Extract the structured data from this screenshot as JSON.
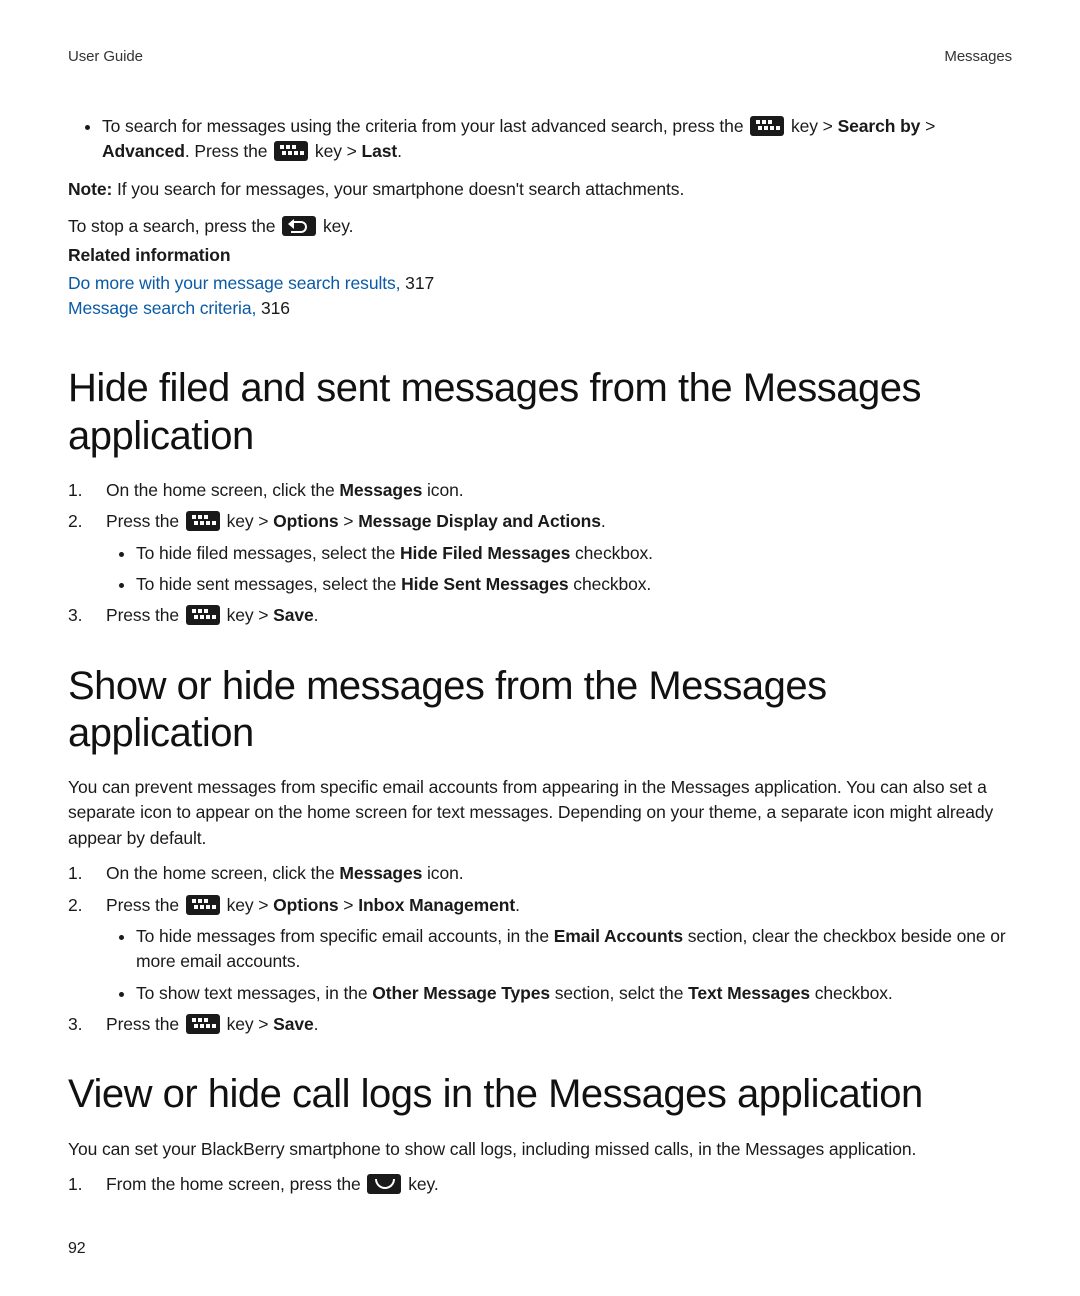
{
  "header": {
    "left": "User Guide",
    "right": "Messages"
  },
  "iconAlt": {
    "menu": "Menu key",
    "back": "Escape key",
    "send": "Send key"
  },
  "intro": {
    "bullet_pre": "To search for messages using the criteria from your last advanced search, press the ",
    "bullet_key1_after": " key > ",
    "bullet_searchby": "Search by",
    "bullet_gt1": " > ",
    "bullet_advanced": "Advanced",
    "bullet_pressthe": ". Press the ",
    "bullet_key2_after": " key > ",
    "bullet_last": "Last",
    "bullet_period": "."
  },
  "note": {
    "label": "Note:",
    "text": " If you search for messages, your smartphone doesn't search attachments."
  },
  "stop": {
    "pre": "To stop a search, press the ",
    "post": " key."
  },
  "related": {
    "heading": "Related information",
    "link1": "Do more with your message search results,",
    "link1_pg": " 317",
    "link2": "Message search criteria,",
    "link2_pg": " 316"
  },
  "sec1": {
    "heading": "Hide filed and sent messages from the Messages application",
    "s1_pre": "On the home screen, click the ",
    "s1_bold": "Messages",
    "s1_post": " icon.",
    "s2_pre": "Press the ",
    "s2_key_after": " key > ",
    "s2_options": "Options",
    "s2_gt": " > ",
    "s2_mda": "Message Display and Actions",
    "s2_period": ".",
    "s2_sub1_pre": "To hide filed messages, select the ",
    "s2_sub1_bold": "Hide Filed Messages",
    "s2_sub1_post": " checkbox.",
    "s2_sub2_pre": "To hide sent messages, select the ",
    "s2_sub2_bold": "Hide Sent Messages",
    "s2_sub2_post": " checkbox.",
    "s3_pre": "Press the ",
    "s3_key_after": " key > ",
    "s3_save": "Save",
    "s3_period": "."
  },
  "sec2": {
    "heading": "Show or hide messages from the Messages application",
    "desc": "You can prevent messages from specific email accounts from appearing in the Messages application. You can also set a separate icon to appear on the home screen for text messages. Depending on your theme, a separate icon might already appear by default.",
    "s1_pre": "On the home screen, click the ",
    "s1_bold": "Messages",
    "s1_post": " icon.",
    "s2_pre": "Press the ",
    "s2_key_after": " key > ",
    "s2_options": "Options",
    "s2_gt": " > ",
    "s2_im": "Inbox Management",
    "s2_period": ".",
    "s2_sub1_pre": "To hide messages from specific email accounts, in the ",
    "s2_sub1_bold": "Email Accounts",
    "s2_sub1_post": " section, clear the checkbox beside one or more email accounts.",
    "s2_sub2_pre": "To show text messages, in the ",
    "s2_sub2_bold1": "Other Message Types",
    "s2_sub2_mid": " section, selct the ",
    "s2_sub2_bold2": "Text Messages",
    "s2_sub2_post": " checkbox.",
    "s3_pre": "Press the ",
    "s3_key_after": " key > ",
    "s3_save": "Save",
    "s3_period": "."
  },
  "sec3": {
    "heading": "View or hide call logs in the Messages application",
    "desc": "You can set your BlackBerry smartphone to show call logs, including missed calls, in the Messages application.",
    "s1_pre": "From the home screen, press the ",
    "s1_post": " key."
  },
  "pageNumber": "92"
}
